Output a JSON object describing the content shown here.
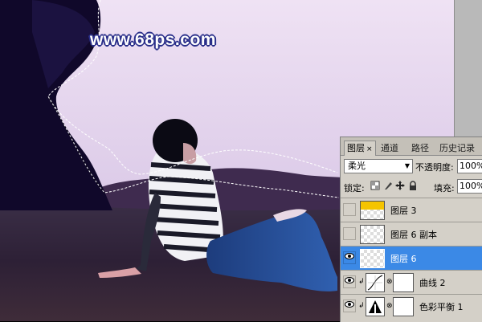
{
  "watermark": "www.68ps.com",
  "layers_panel": {
    "tabs": [
      {
        "label": "图层",
        "close": "×"
      },
      {
        "label": "通道"
      },
      {
        "label": "路径"
      },
      {
        "label": "历史记录"
      }
    ],
    "blend_mode": "柔光",
    "opacity_label": "不透明度:",
    "opacity_value": "100%",
    "lock_label": "锁定:",
    "fill_label": "填充:",
    "fill_value": "100%",
    "layers": [
      {
        "name": "图层 3",
        "visible": false,
        "thumb": "yellow"
      },
      {
        "name": "图层 6 副本",
        "visible": false,
        "thumb": "transparent"
      },
      {
        "name": "图层 6",
        "visible": true,
        "thumb": "transparent",
        "selected": true
      },
      {
        "name": "曲线 2",
        "visible": true,
        "type": "curves-adjustment"
      },
      {
        "name": "色彩平衡 1",
        "visible": true,
        "type": "color-balance-adjustment"
      }
    ],
    "colors": {
      "selected": "#3b89e6",
      "panel": "#d4d0c8",
      "thumb_yellow": "#f5c400"
    }
  }
}
